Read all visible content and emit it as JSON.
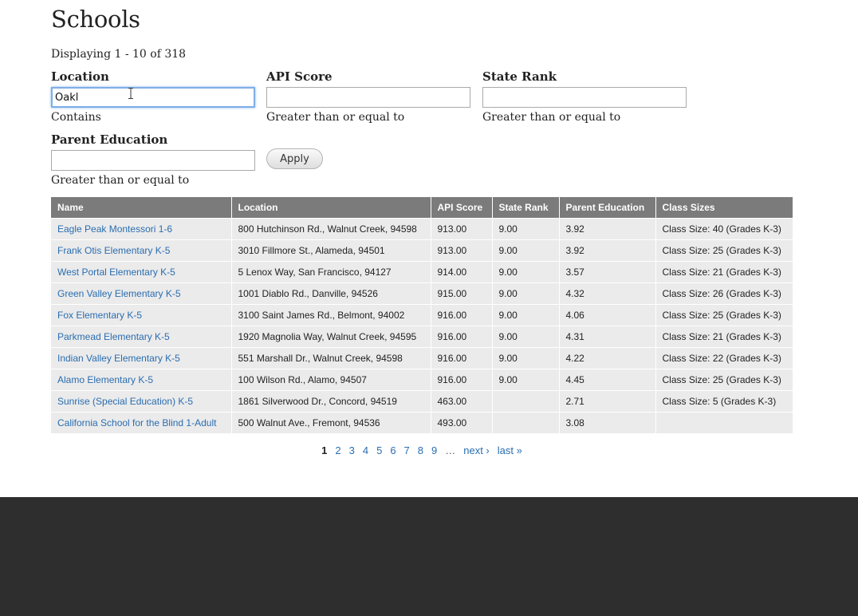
{
  "page": {
    "title": "Schools",
    "summary": "Displaying 1 - 10 of 318"
  },
  "filters": {
    "location": {
      "label": "Location",
      "value": "Oakl",
      "placeholder": "",
      "desc": "Contains"
    },
    "api_score": {
      "label": "API Score",
      "value": "",
      "placeholder": "",
      "desc": "Greater than or equal to"
    },
    "state_rank": {
      "label": "State Rank",
      "value": "",
      "placeholder": "",
      "desc": "Greater than or equal to"
    },
    "parent_education": {
      "label": "Parent Education",
      "value": "",
      "placeholder": "",
      "desc": "Greater than or equal to"
    },
    "apply_label": "Apply"
  },
  "table": {
    "headers": [
      "Name",
      "Location",
      "API Score",
      "State Rank",
      "Parent Education",
      "Class Sizes"
    ],
    "rows": [
      [
        "Eagle Peak Montessori 1-6",
        "800 Hutchinson Rd., Walnut Creek, 94598",
        "913.00",
        "9.00",
        "3.92",
        "Class Size: 40 (Grades K-3)"
      ],
      [
        "Frank Otis Elementary K-5",
        "3010 Fillmore St., Alameda, 94501",
        "913.00",
        "9.00",
        "3.92",
        "Class Size: 25 (Grades K-3)"
      ],
      [
        "West Portal Elementary K-5",
        "5 Lenox Way, San Francisco, 94127",
        "914.00",
        "9.00",
        "3.57",
        "Class Size: 21 (Grades K-3)"
      ],
      [
        "Green Valley Elementary K-5",
        "1001 Diablo Rd., Danville, 94526",
        "915.00",
        "9.00",
        "4.32",
        "Class Size: 26 (Grades K-3)"
      ],
      [
        "Fox Elementary K-5",
        "3100 Saint James Rd., Belmont, 94002",
        "916.00",
        "9.00",
        "4.06",
        "Class Size: 25 (Grades K-3)"
      ],
      [
        "Parkmead Elementary K-5",
        "1920 Magnolia Way, Walnut Creek, 94595",
        "916.00",
        "9.00",
        "4.31",
        "Class Size: 21 (Grades K-3)"
      ],
      [
        "Indian Valley Elementary K-5",
        "551 Marshall Dr., Walnut Creek, 94598",
        "916.00",
        "9.00",
        "4.22",
        "Class Size: 22 (Grades K-3)"
      ],
      [
        "Alamo Elementary K-5",
        "100 Wilson Rd., Alamo, 94507",
        "916.00",
        "9.00",
        "4.45",
        "Class Size: 25 (Grades K-3)"
      ],
      [
        "Sunrise (Special Education) K-5",
        "1861 Silverwood Dr., Concord, 94519",
        "463.00",
        "",
        "2.71",
        "Class Size: 5 (Grades K-3)"
      ],
      [
        "California School for the Blind 1-Adult",
        "500 Walnut Ave., Fremont, 94536",
        "493.00",
        "",
        "3.08",
        ""
      ]
    ]
  },
  "pager": {
    "current": "1",
    "pages": [
      "2",
      "3",
      "4",
      "5",
      "6",
      "7",
      "8",
      "9"
    ],
    "ellipsis": "…",
    "next": "next ›",
    "last": "last »"
  },
  "icons": {
    "text_cursor": "text-cursor-icon"
  }
}
